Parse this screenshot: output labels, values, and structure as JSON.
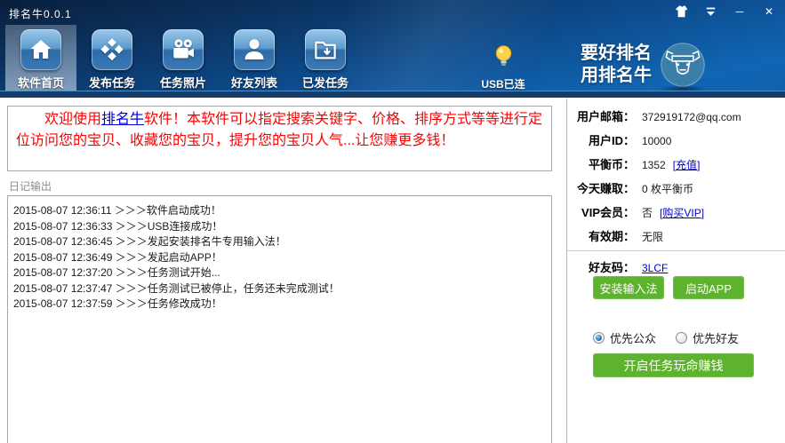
{
  "window": {
    "title": "排名牛0.0.1",
    "controls": {
      "minimize_glyph": "─",
      "close_glyph": "✕"
    }
  },
  "nav": {
    "items": [
      {
        "label": "软件首页",
        "active": true
      },
      {
        "label": "发布任务",
        "active": false
      },
      {
        "label": "任务照片",
        "active": false
      },
      {
        "label": "好友列表",
        "active": false
      },
      {
        "label": "已发任务",
        "active": false
      }
    ],
    "usb_label": "USB已连",
    "slogan": {
      "line1": "要好排名",
      "line2": "用排名牛"
    }
  },
  "welcome": {
    "prefix": "欢迎使用",
    "link": "排名牛",
    "body": "软件！本软件可以指定搜索关键字、价格、排序方式等等进行定位访问您的宝贝、收藏您的宝贝，提升您的宝贝人气...让您赚更多钱！"
  },
  "log": {
    "header": "日记输出",
    "entries": [
      "2015-08-07 12:36:11 ＞＞＞软件启动成功！",
      "2015-08-07 12:36:33 ＞＞＞USB连接成功！",
      "2015-08-07 12:36:45 ＞＞＞发起安装排名牛专用输入法！",
      "2015-08-07 12:36:49 ＞＞＞发起启动APP！",
      "2015-08-07 12:37:20 ＞＞＞任务测试开始...",
      "2015-08-07 12:37:47 ＞＞＞任务测试已被停止，任务还未完成测试！",
      "2015-08-07 12:37:59 ＞＞＞任务修改成功！"
    ]
  },
  "account": {
    "rows": [
      {
        "label": "用户邮箱：",
        "value": "372919172@qq.com"
      },
      {
        "label": "用户ID：",
        "value": "10000"
      },
      {
        "label": "平衡币：",
        "value": "1352",
        "pre": "[",
        "link": "充值",
        "post": "]"
      },
      {
        "label": "今天赚取：",
        "value": "0 枚平衡币"
      },
      {
        "label": "VIP会员：",
        "value": "否",
        "pre": "[",
        "link": "购买VIP",
        "post": "]"
      },
      {
        "label": "有效期：",
        "value": "无限"
      },
      {
        "label": "好友码：",
        "link": "3LCF"
      }
    ]
  },
  "actions": {
    "install_ime": "安装输入法",
    "launch_app": "启动APP",
    "radio_public": "优先公众",
    "radio_public_checked": true,
    "radio_friend": "优先好友",
    "radio_friend_checked": false,
    "start_task": "开启任务玩命赚钱"
  },
  "colors": {
    "accent_green": "#5db22e",
    "welcome_red": "#fe0000",
    "link_blue": "#0000cc",
    "titlebar_navy": "#081f3c",
    "nav_blue": "#1066b4",
    "bulb_yellow": "#ffd24a"
  }
}
